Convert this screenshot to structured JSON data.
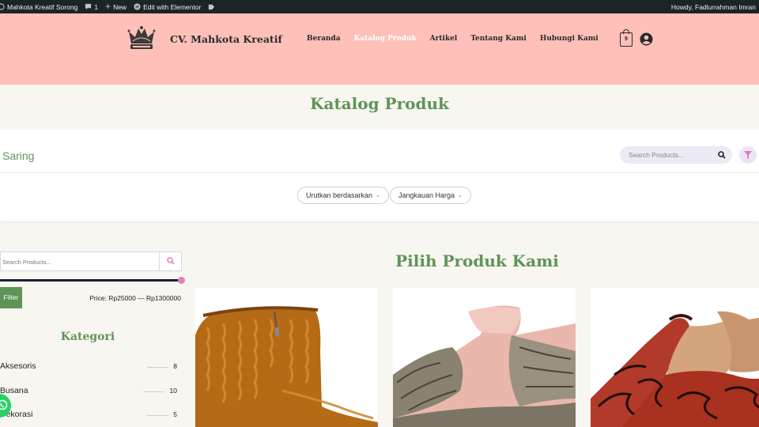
{
  "admin_bar": {
    "site_name": "Mahkota Kreatif Sorong",
    "comments_count": "1",
    "new_label": "New",
    "elementor_label": "Edit with Elementor",
    "howdy": "Howdy, Fadlurrahman Imran"
  },
  "header": {
    "brand": "CV. Mahkota Kreatif",
    "nav": [
      "Beranda",
      "Katalog Produk",
      "Artikel",
      "Tentang Kami",
      "Hubungi Kami"
    ],
    "active_nav": "Katalog Produk",
    "cart_count": "9",
    "background": "#ffc0b9"
  },
  "page_title": "Katalog Produk",
  "filter_panel": {
    "title": "Saring",
    "search_placeholder": "Search Products...",
    "sort_label": "Urutkan berdasarkan",
    "price_range_label": "Jangkauan Harga"
  },
  "sidebar": {
    "search_placeholder": "Search Products...",
    "filter_button": "Filter",
    "price_text": "Price: Rp25000 — Rp1300000",
    "categories_title": "Kategori",
    "categories": [
      {
        "name": "Aksesoris",
        "count": "8"
      },
      {
        "name": "Busana",
        "count": "10"
      },
      {
        "name": "Dekorasi",
        "count": "5"
      }
    ]
  },
  "products_title": "Pilih Produk Kami",
  "products": [
    {
      "image": "knitted-mustard-booties"
    },
    {
      "image": "pink-sandals-with-woven-straps"
    },
    {
      "image": "red-patterned-slippers"
    }
  ],
  "colors": {
    "accent_green": "#5f9458",
    "page_bg": "#f7f6f0",
    "admin_bar": "#1d2327",
    "range_handle": "#e07fc0"
  }
}
